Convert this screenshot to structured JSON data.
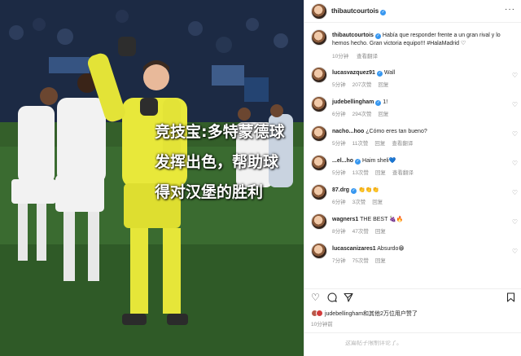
{
  "overlay": {
    "line1": "竞技宝:多特蒙德球",
    "line2": "发挥出色，帮助球",
    "line3": "得对汉堡的胜利"
  },
  "post": {
    "author": "thibautcourtois",
    "caption_user": "thibautcourtois",
    "caption_text": "Había que responder frente a un gran rival y lo hemos hecho. Gran victoria equipo!!! #HalaMadrid ♡",
    "caption_time": "10分钟",
    "caption_translate": "查看翻译"
  },
  "comments": [
    {
      "user": "lucasvazquez91",
      "text": "Wall",
      "time": "5分钟",
      "likes": "207次赞",
      "reply": "回复",
      "translate": ""
    },
    {
      "user": "judebellingham",
      "text": "1!",
      "time": "6分钟",
      "likes": "294次赞",
      "reply": "回复",
      "translate": ""
    },
    {
      "user": "nacho...hoo",
      "text": "¿Cómo eres tan bueno?",
      "time": "5分钟",
      "likes": "11次赞",
      "reply": "回复",
      "translate": "查看翻译"
    },
    {
      "user": "...el...ho",
      "text": "Haim sheli💙",
      "time": "5分钟",
      "likes": "13次赞",
      "reply": "回复",
      "translate": "查看翻译"
    },
    {
      "user": "87.drg",
      "text": "👏👏👏",
      "time": "6分钟",
      "likes": "3次赞",
      "reply": "回复",
      "translate": ""
    },
    {
      "user": "wagners1",
      "text": "THE BEST 🍇🔥",
      "time": "8分钟",
      "likes": "47次赞",
      "reply": "回复",
      "translate": ""
    },
    {
      "user": "lucascanizares1",
      "text": "Absurdo😁",
      "time": "7分钟",
      "likes": "75次赞",
      "reply": "回复",
      "translate": ""
    }
  ],
  "likes_text": "judebellingham和其他2万位用户赞了",
  "time_ago": "10分钟前",
  "comment_placeholder": "这篇帖子限制评论了。",
  "icons": {
    "more": "more-horizontal-icon",
    "heart": "heart-icon",
    "comment": "comment-icon",
    "share": "share-icon",
    "bookmark": "bookmark-icon"
  },
  "colors": {
    "verified": "#3797f0",
    "overlay_text": "#ffffff",
    "jersey_yellow": "#e8e83a"
  }
}
